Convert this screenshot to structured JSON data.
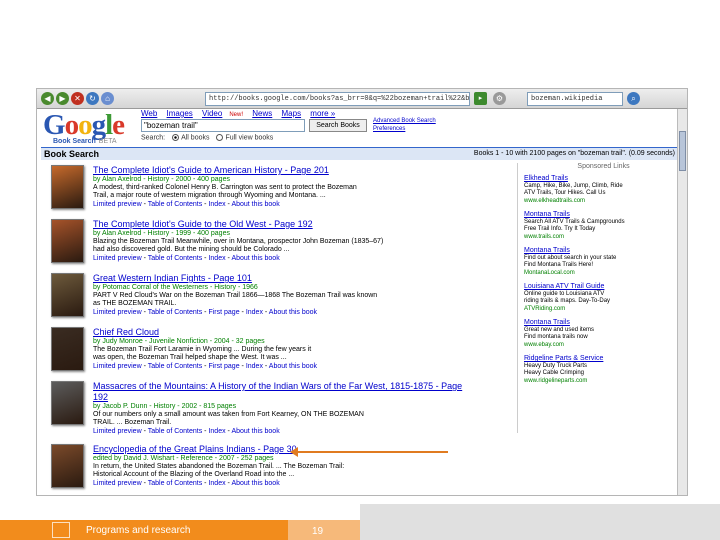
{
  "browser": {
    "address": "http://books.google.com/books?as_brr=0&q=%22bozeman+trail%22&btnG=Search+Books",
    "search_box": "bozeman.wikipedia"
  },
  "google": {
    "logo_letters": [
      "G",
      "o",
      "o",
      "g",
      "l",
      "e"
    ],
    "logo_colors": [
      "#2a57b2",
      "#d9392a",
      "#f2b30f",
      "#2a57b2",
      "#3d9a35",
      "#d9392a"
    ],
    "logo_sub": "Book Search",
    "logo_beta": "BETA",
    "nav": [
      {
        "label": "Web",
        "current": false
      },
      {
        "label": "Images",
        "current": false
      },
      {
        "label": "Video",
        "current": false,
        "badge": "New!"
      },
      {
        "label": "News",
        "current": false
      },
      {
        "label": "Maps",
        "current": false
      },
      {
        "label": "more »",
        "current": false
      }
    ],
    "query": "\"bozeman trail\"",
    "search_button": "Search Books",
    "adv_links": [
      "Advanced Book Search",
      "Preferences"
    ],
    "search_label": "Search:",
    "radio_all": "All books",
    "radio_full": "Full view books"
  },
  "results_bar": {
    "title": "Book Search",
    "stats": "Books 1 - 10 with 2100 pages on \"bozeman trail\". (0.09 seconds)"
  },
  "results": [
    {
      "title": "The Complete Idiot's Guide to American History - Page 201",
      "meta": "by Alan Axelrod - History - 2000 - 400 pages",
      "snippet": [
        "A modest, third-ranked Colonel Henry B. Carrington was sent to protect the Bozeman",
        "Trail, a major route of western migration through Wyoming and Montana. ..."
      ],
      "links": [
        "Limited preview",
        "Table of Contents",
        "Index",
        "About this book"
      ],
      "cover_color": "#c66a2c"
    },
    {
      "title": "The Complete Idiot's Guide to the Old West - Page 192",
      "meta": "by Alan Axelrod - History - 1999 - 400 pages",
      "snippet": [
        "Blazing the Bozeman Trail Meanwhile, over in Montana, prospector John Bozeman (1835–67)",
        "had also discovered gold. But the mining should be Colorado ..."
      ],
      "links": [
        "Limited preview",
        "Table of Contents",
        "Index",
        "About this book"
      ],
      "cover_color": "#a6532a"
    },
    {
      "title": "Great Western Indian Fights - Page 101",
      "meta": "by Potomac Corral of the Westerners - History - 1966",
      "snippet": [
        "PART V Red Cloud's War on the Bozeman Trail 1866—1868 The Bozeman Trail was known",
        "as THE BOZEMAN TRAIL."
      ],
      "links": [
        "Limited preview",
        "Table of Contents",
        "First page",
        "Index",
        "About this book"
      ],
      "cover_color": "#6d5a3c"
    },
    {
      "title": "Chief Red Cloud",
      "meta": "by Judy Monroe - Juvenile Nonfiction - 2004 - 32 pages",
      "snippet": [
        "The Bozeman Trail Fort Laramie in Wyoming ... During the few years it",
        "was open, the Bozeman Trail helped shape the West. It was ..."
      ],
      "links": [
        "Limited preview",
        "Table of Contents",
        "First page",
        "Index",
        "About this book"
      ],
      "cover_color": "#3a2c22"
    },
    {
      "title": "Massacres of the Mountains: A History of the Indian Wars of the Far West, 1815-1875 - Page",
      "title2": "192",
      "meta": "by Jacob P. Dunn - History - 2002 - 815 pages",
      "snippet": [
        "Of our numbers only a small amount was taken from Fort Kearney, ON THE BOZEMAN",
        "TRAIL. ... Bozeman Trail."
      ],
      "links": [
        "Limited preview",
        "Table of Contents",
        "Index",
        "About this book"
      ],
      "cover_color": "#5c5c5c"
    },
    {
      "title": "Encyclopedia of the Great Plains Indians - Page 30",
      "meta": "edited by David J. Wishart - Reference - 2007 - 252 pages",
      "snippet": [
        "In return, the United States abandoned the Bozeman Trail. ... The Bozeman Trail:",
        "Historical Account of the Blazing of the Overland Road into the ..."
      ],
      "links": [
        "Limited preview",
        "Table of Contents",
        "Index",
        "About this book"
      ],
      "cover_color": "#7b4a2a"
    }
  ],
  "sponsored": {
    "heading": "Sponsored Links",
    "ads": [
      {
        "title": "Elkhead Trails",
        "desc": [
          "Camp, Hike, Bike, Jump, Climb, Ride",
          "ATV Trails, Tour Hikes. Call Us"
        ],
        "url": "www.elkheadtrails.com"
      },
      {
        "title": "Montana Trails",
        "desc": [
          "Search All ATV Trails & Campgrounds",
          "Free Trail Info. Try It Today"
        ],
        "url": "www.trails.com"
      },
      {
        "title": "Montana Trails",
        "desc": [
          "Find out about search in your state",
          "Find Montana Trails Here!"
        ],
        "url": "MontanaLocal.com"
      },
      {
        "title": "Louisiana ATV Trail Guide",
        "desc": [
          "Online guide to Louisiana ATV",
          "riding trails & maps. Day-To-Day"
        ],
        "url": "ATVRiding.com"
      },
      {
        "title": "Montana Trails",
        "desc": [
          "Great new and used items",
          "Find montana trails now"
        ],
        "url": "www.ebay.com"
      },
      {
        "title": "Ridgeline Parts & Service",
        "desc": [
          "Heavy Duty Truck Parts",
          "Heavy Cable Crimping"
        ],
        "url": "www.ridgelineparts.com"
      }
    ]
  },
  "footer": {
    "label": "Programs and research",
    "page": "19"
  }
}
